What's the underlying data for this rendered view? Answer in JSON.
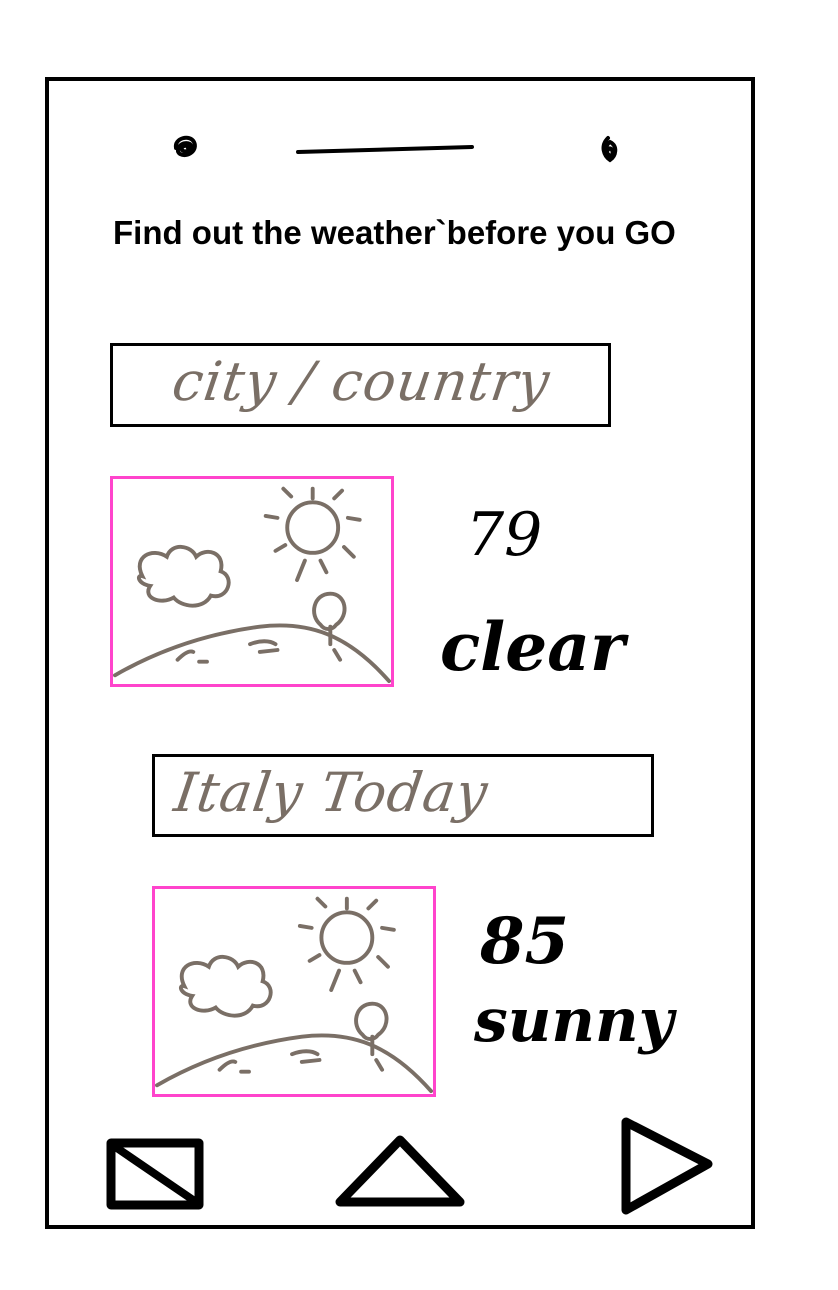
{
  "header": {
    "headline": "Find out the weather`before you GO"
  },
  "search": {
    "value": "city / country"
  },
  "current": {
    "temperature": "79",
    "condition": "clear",
    "image_icon": "weather-landscape-sun-cloud"
  },
  "location_title": {
    "label": "Italy Today"
  },
  "forecast": {
    "temperature": "85",
    "condition": "sunny",
    "image_icon": "weather-landscape-sun-cloud"
  },
  "nav": {
    "left_icon": "square-slash-icon",
    "center_icon": "triangle-up-icon",
    "right_icon": "triangle-right-icon"
  },
  "colors": {
    "frame": "#000000",
    "image_border": "#ff44cc",
    "sketch": "#7a6f66"
  }
}
